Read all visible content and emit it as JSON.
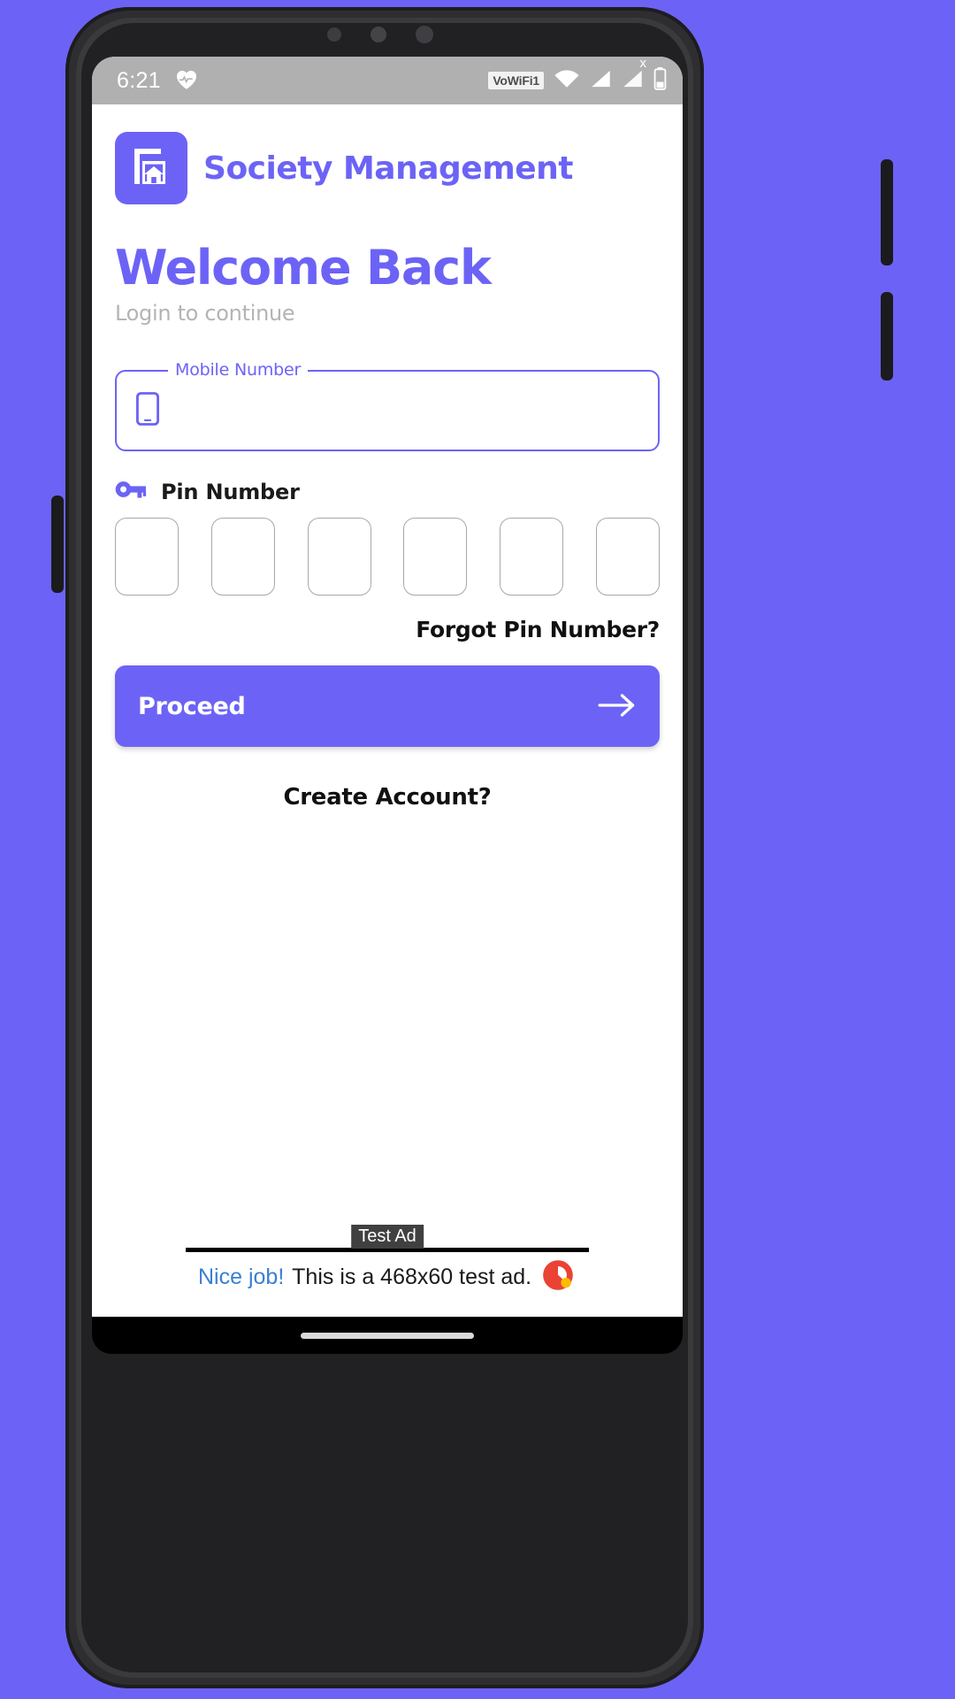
{
  "device": {
    "name": "android-phone-mockup"
  },
  "status_bar": {
    "time": "6:21",
    "health_icon": "heart-icon",
    "vowifi_badge": "VoWiFi1",
    "wifi_icon": "wifi-icon",
    "signal_icon": "signal-bars-icon",
    "signal_x_icon": "signal-no-service-icon",
    "battery_icon": "battery-icon",
    "background": "#b0b0b0"
  },
  "app": {
    "logo_icon": "society-house-sign-icon",
    "title": "Society Management",
    "accent_color": "#6C63F6",
    "heading": "Welcome Back",
    "subtitle": "Login to continue"
  },
  "form": {
    "mobile": {
      "label": "Mobile Number",
      "value": "",
      "placeholder": "",
      "icon": "mobile-phone-icon"
    },
    "pin": {
      "icon": "key-icon",
      "label": "Pin Number",
      "digits": [
        "",
        "",
        "",
        "",
        "",
        ""
      ],
      "count": 6
    },
    "forgot_pin_label": "Forgot Pin Number?",
    "proceed_label": "Proceed",
    "proceed_icon": "arrow-right-icon",
    "create_account_label": "Create Account?"
  },
  "ad": {
    "test_tag": "Test Ad",
    "cta": "Nice job!",
    "body": "This is a 468x60 test ad.",
    "logo_icon": "admob-logo-icon"
  },
  "nav_bar": {
    "gesture_pill": "home-gesture-pill"
  }
}
